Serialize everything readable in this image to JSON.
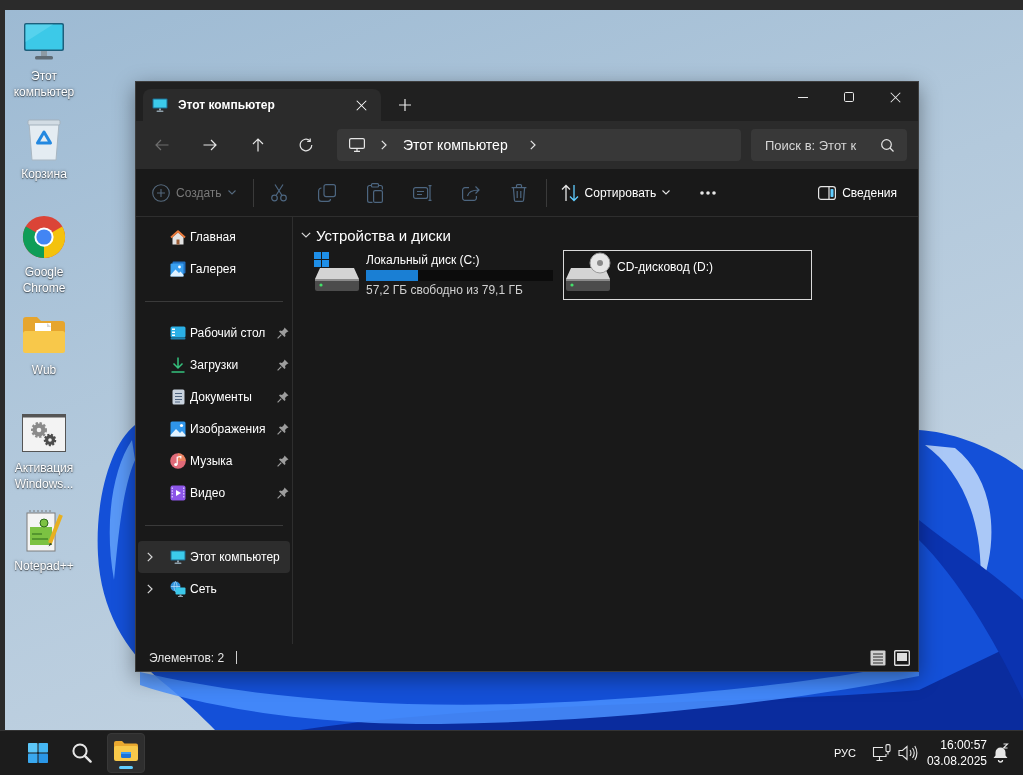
{
  "desktop": {
    "shortcuts": [
      {
        "label": "Этот компьютер"
      },
      {
        "label": "Корзина"
      },
      {
        "label": "Google Chrome"
      },
      {
        "label": "Wub"
      },
      {
        "label": "Активация Windows..."
      },
      {
        "label": "Notepad++"
      }
    ]
  },
  "explorer": {
    "tabs": [
      {
        "title": "Этот компьютер",
        "selected": true
      }
    ],
    "nav_buttons": [
      {
        "disabled": true
      },
      {
        "disabled": false
      },
      {
        "disabled": false
      },
      {
        "disabled": false
      }
    ],
    "address": {
      "crumbs": [
        "Этот компьютер"
      ]
    },
    "search": {
      "placeholder": "Поиск в: Этот к"
    },
    "toolbar": {
      "new_button": {
        "label": "Создать",
        "disabled": true
      },
      "actions": [
        {
          "disabled": true
        },
        {
          "disabled": true
        },
        {
          "disabled": true
        },
        {
          "disabled": true
        },
        {
          "disabled": true
        },
        {
          "disabled": true
        }
      ],
      "sort_button": {
        "label": "Сортировать",
        "disabled": false
      },
      "details_button": {
        "label": "Сведения"
      }
    },
    "sidebar": {
      "quick": [
        {
          "label": "Главная",
          "pinned": false,
          "selected": false
        },
        {
          "label": "Галерея",
          "pinned": false,
          "selected": false
        }
      ],
      "pinned": [
        {
          "label": "Рабочий стол",
          "pinned": true,
          "selected": false
        },
        {
          "label": "Загрузки",
          "pinned": true,
          "selected": false
        },
        {
          "label": "Документы",
          "pinned": true,
          "selected": false
        },
        {
          "label": "Изображения",
          "pinned": true,
          "selected": false
        },
        {
          "label": "Музыка",
          "pinned": true,
          "selected": false
        },
        {
          "label": "Видео",
          "pinned": true,
          "selected": false
        }
      ],
      "tree": [
        {
          "label": "Этот компьютер",
          "expanded": false,
          "selected": true
        },
        {
          "label": "Сеть",
          "expanded": false,
          "selected": false
        }
      ]
    },
    "section": {
      "title": "Устройства и диски",
      "expanded": true,
      "drives": [
        {
          "kind": "disk",
          "name": "Локальный диск (C:)",
          "level": 0.28,
          "free_space": "57,2 ГБ свободно из 79,1 ГБ",
          "selected": false
        },
        {
          "kind": "optical",
          "name": "CD-дисковод (D:)",
          "selected": true
        }
      ]
    },
    "status_bar": {
      "item_count": "Элементов: 2"
    }
  },
  "taskbar": {
    "apps": [
      {
        "running": true,
        "active": true
      }
    ],
    "language": "РУС",
    "time": "16:00:57",
    "date": "03.08.2025"
  }
}
